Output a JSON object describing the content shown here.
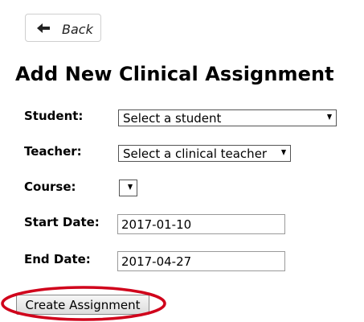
{
  "back_button": {
    "label": "Back",
    "icon": "arrow-left-icon"
  },
  "page_title": "Add New Clinical Assignment",
  "form": {
    "student": {
      "label": "Student:",
      "value": "Select a student"
    },
    "teacher": {
      "label": "Teacher:",
      "value": "Select a clinical teacher"
    },
    "course": {
      "label": "Course:",
      "value": ""
    },
    "start_date": {
      "label": "Start Date:",
      "value": "2017-01-10"
    },
    "end_date": {
      "label": "End Date:",
      "value": "2017-04-27"
    }
  },
  "submit_label": "Create Assignment",
  "colors": {
    "highlight": "#d0021b",
    "text": "#000000",
    "button_border": "#cfcfcf"
  }
}
